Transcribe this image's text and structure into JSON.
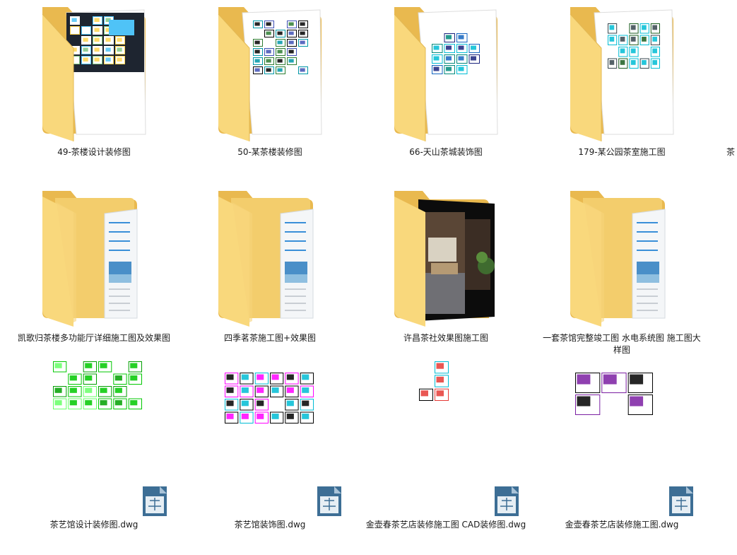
{
  "view": "large-icons",
  "items": [
    {
      "name": "49-茶楼设计装修图",
      "type": "folder",
      "preview": "cad-dark"
    },
    {
      "name": "50-某茶楼装修图",
      "type": "folder",
      "preview": "cad-white"
    },
    {
      "name": "66-天山茶城装饰图",
      "type": "folder",
      "preview": "cad-blue"
    },
    {
      "name": "179-某公园茶室施工图",
      "type": "folder",
      "preview": "cad-cyan"
    },
    {
      "name": "凯歌归茶楼多功能厅详细施工图及效果图",
      "type": "folder",
      "preview": "document"
    },
    {
      "name": "四季茗茶施工图+效果图",
      "type": "folder",
      "preview": "document"
    },
    {
      "name": "许昌茶社效果图施工图",
      "type": "folder",
      "preview": "photo"
    },
    {
      "name": "一套茶馆完整竣工图 水电系统图 施工图大样图",
      "type": "folder",
      "preview": "document"
    },
    {
      "name": "茶艺馆设计装修图.dwg",
      "type": "dwg",
      "preview": "cad-green"
    },
    {
      "name": "茶艺馆装饰图.dwg",
      "type": "dwg",
      "preview": "cad-mixed"
    },
    {
      "name": "金壶春茶艺店装修施工图 CAD装修图.dwg",
      "type": "dwg",
      "preview": "cad-red"
    },
    {
      "name": "金壶春茶艺店装修施工图.dwg",
      "type": "dwg",
      "preview": "cad-purple"
    }
  ],
  "clipped_item_label": "茶",
  "colors": {
    "folder_front": "#f9d87c",
    "folder_back": "#e9b94f",
    "cad_dark": "#1e2530",
    "dwg_icon": "#3d6e95"
  }
}
